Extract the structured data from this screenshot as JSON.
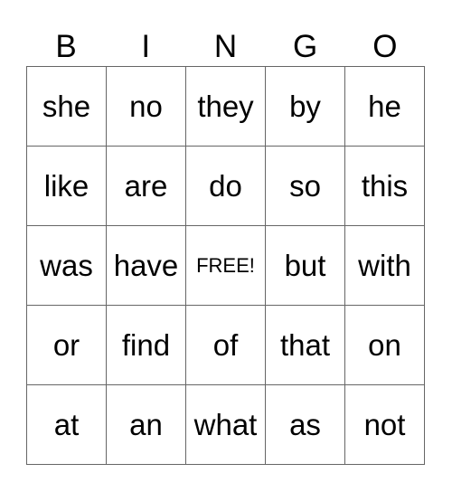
{
  "header": [
    "B",
    "I",
    "N",
    "G",
    "O"
  ],
  "rows": [
    [
      "she",
      "no",
      "they",
      "by",
      "he"
    ],
    [
      "like",
      "are",
      "do",
      "so",
      "this"
    ],
    [
      "was",
      "have",
      "FREE!",
      "but",
      "with"
    ],
    [
      "or",
      "find",
      "of",
      "that",
      "on"
    ],
    [
      "at",
      "an",
      "what",
      "as",
      "not"
    ]
  ]
}
